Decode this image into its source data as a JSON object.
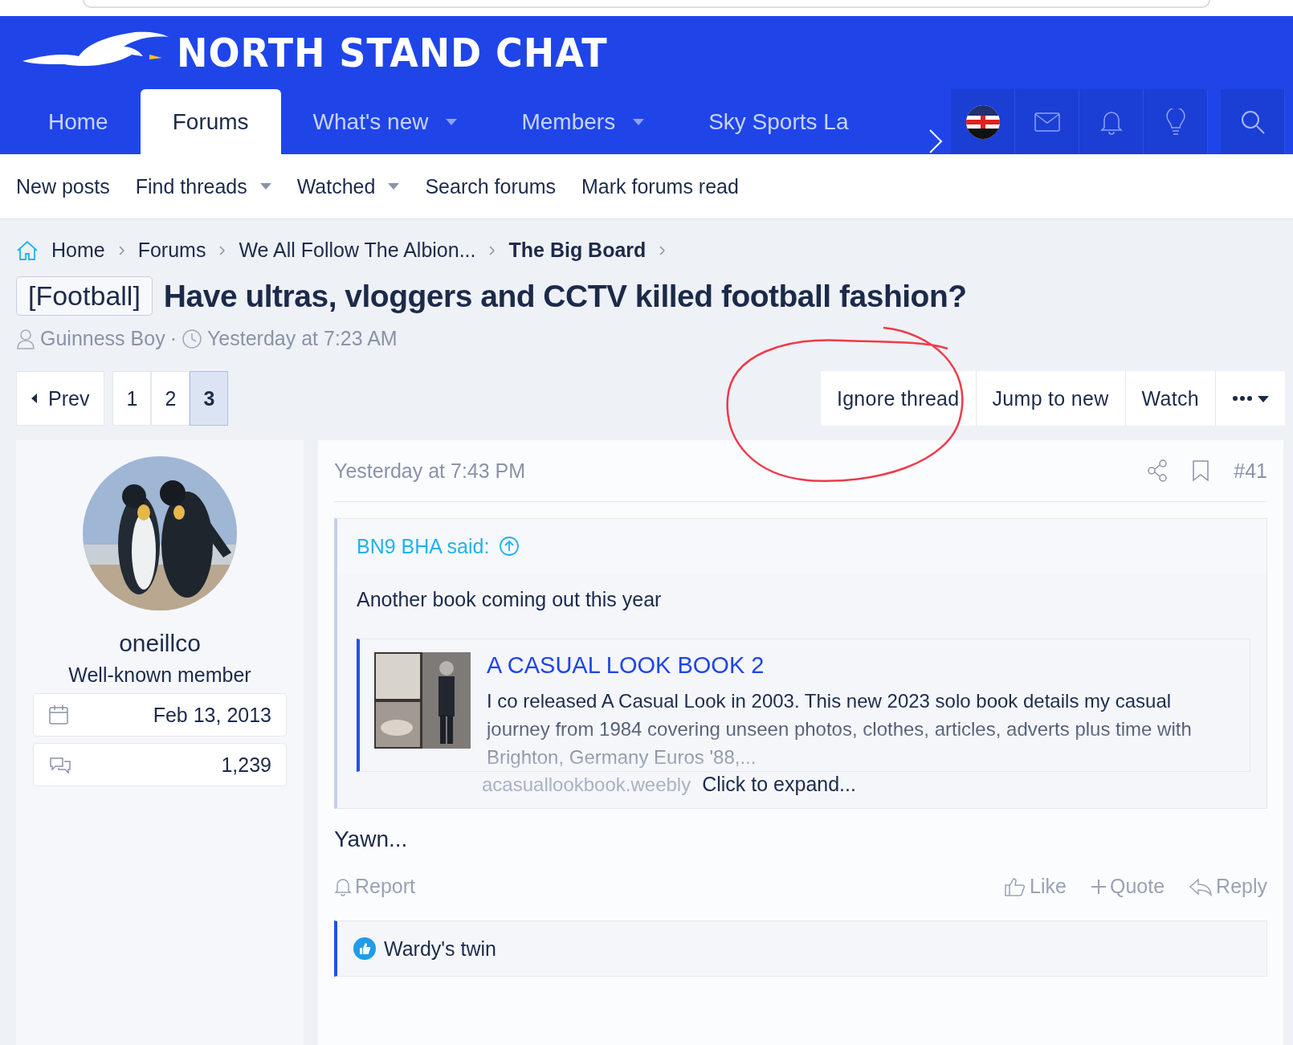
{
  "site": {
    "logo_text": "NORTH STAND CHAT"
  },
  "nav": {
    "tabs": [
      {
        "label": "Home",
        "selected": false,
        "has_menu": false
      },
      {
        "label": "Forums",
        "selected": true,
        "has_menu": false
      },
      {
        "label": "What's new",
        "selected": false,
        "has_menu": true
      },
      {
        "label": "Members",
        "selected": false,
        "has_menu": true
      },
      {
        "label": "Sky Sports La",
        "selected": false,
        "has_menu": false
      }
    ]
  },
  "subnav": [
    {
      "label": "New posts",
      "has_menu": false
    },
    {
      "label": "Find threads",
      "has_menu": true
    },
    {
      "label": "Watched",
      "has_menu": true
    },
    {
      "label": "Search forums",
      "has_menu": false
    },
    {
      "label": "Mark forums read",
      "has_menu": false
    }
  ],
  "breadcrumb": [
    {
      "label": "Home",
      "current": false
    },
    {
      "label": "Forums",
      "current": false
    },
    {
      "label": "We All Follow The Albion...",
      "current": false
    },
    {
      "label": "The Big Board",
      "current": true
    }
  ],
  "thread": {
    "prefix": "[Football]",
    "title": "Have ultras, vloggers and CCTV killed football fashion?",
    "author": "Guinness Boy",
    "separator": "·",
    "date": "Yesterday at 7:23 AM"
  },
  "pagination": {
    "prev": "Prev",
    "pages": [
      {
        "label": "1",
        "selected": false
      },
      {
        "label": "2",
        "selected": false
      },
      {
        "label": "3",
        "selected": true
      }
    ]
  },
  "thread_actions": [
    "Ignore thread",
    "Jump to new",
    "Watch"
  ],
  "post": {
    "user": {
      "name": "oneillco",
      "title": "Well-known member",
      "stats": [
        {
          "kind": "joined",
          "value": "Feb 13, 2013"
        },
        {
          "kind": "messages",
          "value": "1,239"
        }
      ]
    },
    "date": "Yesterday at 7:43 PM",
    "number": "#41",
    "quote": {
      "author": "BN9 BHA said:",
      "text": "Another book coming out this year",
      "link": {
        "title": "A CASUAL LOOK BOOK 2",
        "description": "I co released A Casual Look in 2003. This new 2023 solo book details my casual journey from 1984 covering unseen photos, clothes, articles, adverts plus time with Brighton, Germany Euros '88,...",
        "url": "acasuallookbook.weebly"
      },
      "expand": "Click to expand..."
    },
    "body": "Yawn...",
    "actions_left": [
      {
        "kind": "report",
        "label": "Report"
      }
    ],
    "actions_right": [
      {
        "kind": "like",
        "label": "Like"
      },
      {
        "kind": "quote",
        "label": "Quote"
      },
      {
        "kind": "reply",
        "label": "Reply"
      }
    ],
    "reactions": {
      "users": "Wardy's twin"
    }
  }
}
